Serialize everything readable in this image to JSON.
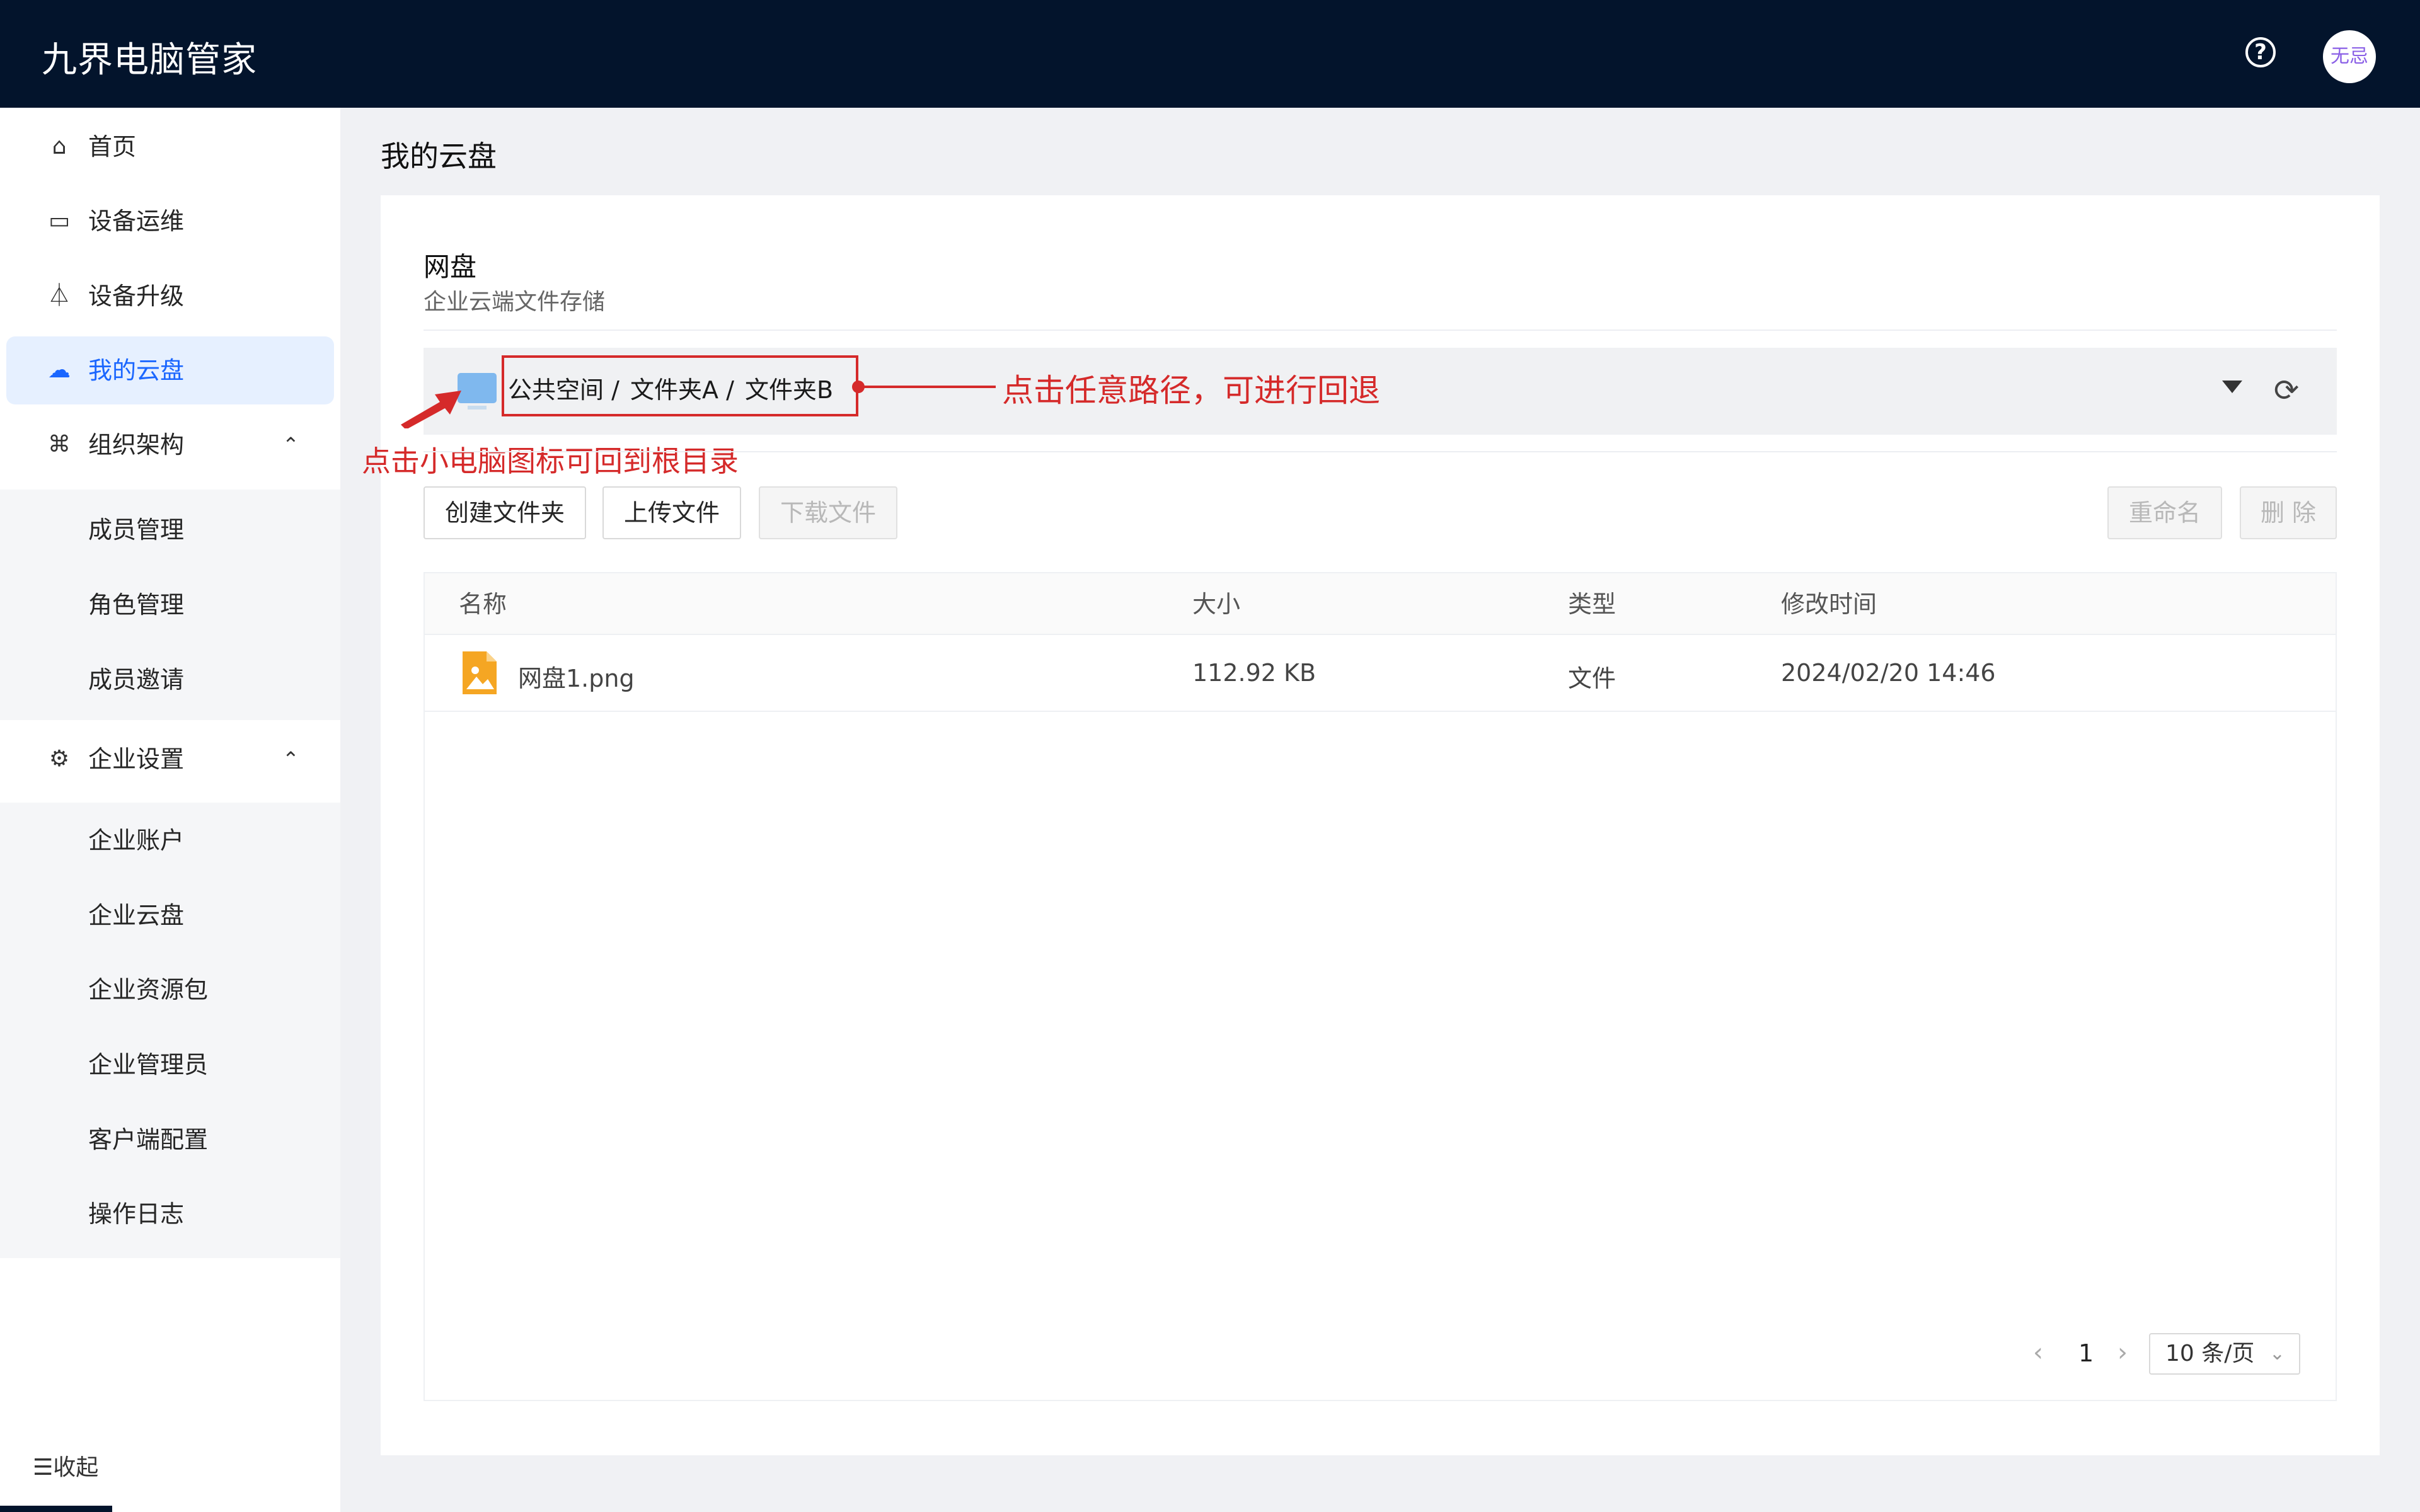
{
  "header": {
    "app_title": "九界电脑管家",
    "help_icon": "question-circle-icon",
    "avatar_text": "无忌"
  },
  "sidebar": {
    "items": [
      {
        "label": "首页",
        "icon": "home-icon"
      },
      {
        "label": "设备运维",
        "icon": "monitor-icon"
      },
      {
        "label": "设备升级",
        "icon": "flask-icon"
      },
      {
        "label": "我的云盘",
        "icon": "cloud-icon",
        "active": true
      },
      {
        "label": "组织架构",
        "icon": "org-chart-icon",
        "expanded": true
      },
      {
        "label": "企业设置",
        "icon": "gear-icon",
        "expanded": true
      }
    ],
    "org_sub": [
      "成员管理",
      "角色管理",
      "成员邀请"
    ],
    "settings_sub": [
      "企业账户",
      "企业云盘",
      "企业资源包",
      "企业管理员",
      "客户端配置",
      "操作日志"
    ],
    "collapse_label": "收起"
  },
  "page": {
    "title": "我的云盘",
    "card_title": "网盘",
    "card_subtitle": "企业云端文件存储"
  },
  "path": {
    "crumbs": [
      "公共空间 /",
      "文件夹A /",
      "文件夹B"
    ]
  },
  "annotations": {
    "path_hint": "点击任意路径，可进行回退",
    "root_hint": "点击小电脑图标可回到根目录"
  },
  "toolbar": {
    "create_folder": "创建文件夹",
    "upload": "上传文件",
    "download": "下载文件",
    "rename": "重命名",
    "delete": "删 除"
  },
  "table": {
    "columns": [
      "名称",
      "大小",
      "类型",
      "修改时间"
    ],
    "rows": [
      {
        "name": "网盘1.png",
        "size": "112.92 KB",
        "type": "文件",
        "modified": "2024/02/20 14:46",
        "icon": "image-file-icon"
      }
    ]
  },
  "pagination": {
    "current_page": "1",
    "page_size": "10 条/页"
  },
  "colors": {
    "header_bg": "#03142c",
    "accent": "#1a66ff",
    "annotation": "#d52a2a"
  }
}
